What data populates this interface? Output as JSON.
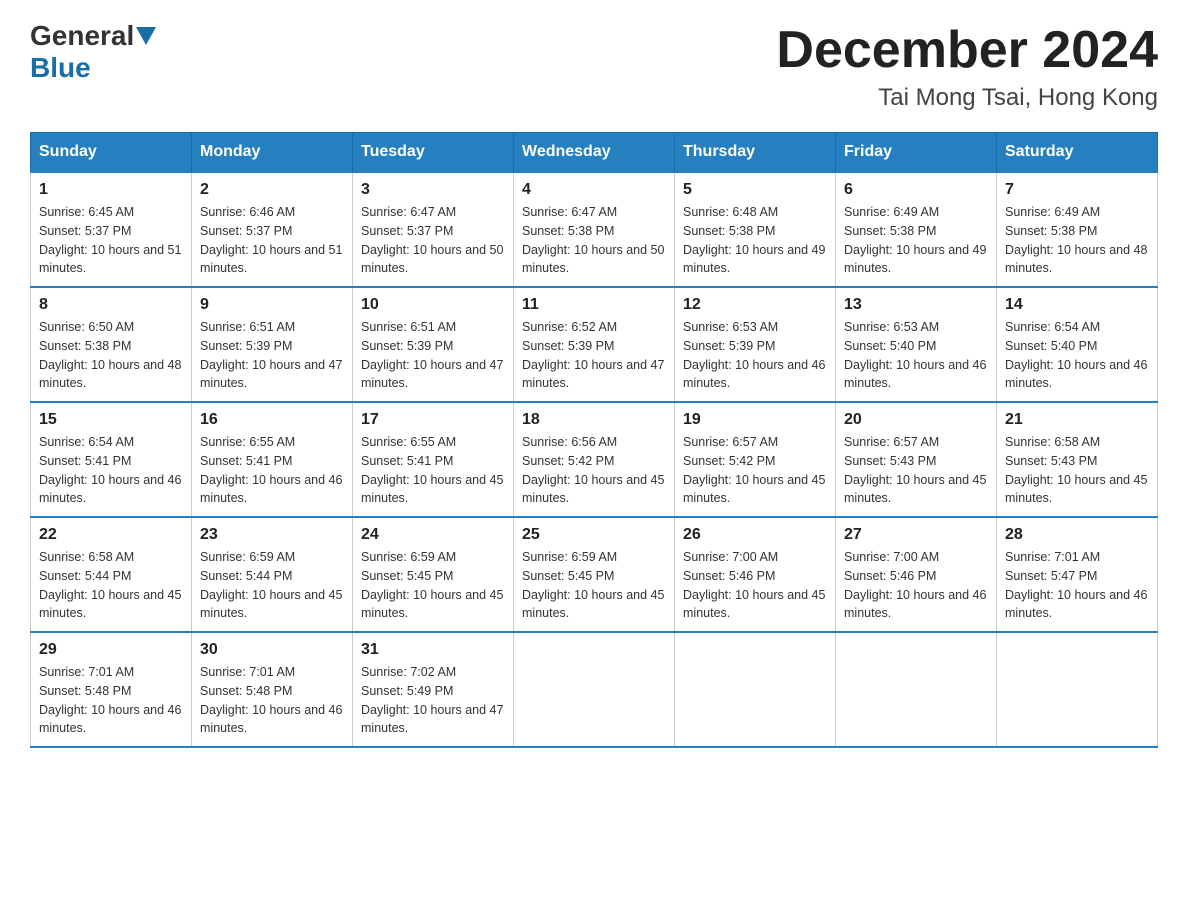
{
  "header": {
    "logo_general": "General",
    "logo_blue": "Blue",
    "month_title": "December 2024",
    "location": "Tai Mong Tsai, Hong Kong"
  },
  "days_of_week": [
    "Sunday",
    "Monday",
    "Tuesday",
    "Wednesday",
    "Thursday",
    "Friday",
    "Saturday"
  ],
  "weeks": [
    [
      {
        "day": "1",
        "sunrise": "6:45 AM",
        "sunset": "5:37 PM",
        "daylight": "10 hours and 51 minutes."
      },
      {
        "day": "2",
        "sunrise": "6:46 AM",
        "sunset": "5:37 PM",
        "daylight": "10 hours and 51 minutes."
      },
      {
        "day": "3",
        "sunrise": "6:47 AM",
        "sunset": "5:37 PM",
        "daylight": "10 hours and 50 minutes."
      },
      {
        "day": "4",
        "sunrise": "6:47 AM",
        "sunset": "5:38 PM",
        "daylight": "10 hours and 50 minutes."
      },
      {
        "day": "5",
        "sunrise": "6:48 AM",
        "sunset": "5:38 PM",
        "daylight": "10 hours and 49 minutes."
      },
      {
        "day": "6",
        "sunrise": "6:49 AM",
        "sunset": "5:38 PM",
        "daylight": "10 hours and 49 minutes."
      },
      {
        "day": "7",
        "sunrise": "6:49 AM",
        "sunset": "5:38 PM",
        "daylight": "10 hours and 48 minutes."
      }
    ],
    [
      {
        "day": "8",
        "sunrise": "6:50 AM",
        "sunset": "5:38 PM",
        "daylight": "10 hours and 48 minutes."
      },
      {
        "day": "9",
        "sunrise": "6:51 AM",
        "sunset": "5:39 PM",
        "daylight": "10 hours and 47 minutes."
      },
      {
        "day": "10",
        "sunrise": "6:51 AM",
        "sunset": "5:39 PM",
        "daylight": "10 hours and 47 minutes."
      },
      {
        "day": "11",
        "sunrise": "6:52 AM",
        "sunset": "5:39 PM",
        "daylight": "10 hours and 47 minutes."
      },
      {
        "day": "12",
        "sunrise": "6:53 AM",
        "sunset": "5:39 PM",
        "daylight": "10 hours and 46 minutes."
      },
      {
        "day": "13",
        "sunrise": "6:53 AM",
        "sunset": "5:40 PM",
        "daylight": "10 hours and 46 minutes."
      },
      {
        "day": "14",
        "sunrise": "6:54 AM",
        "sunset": "5:40 PM",
        "daylight": "10 hours and 46 minutes."
      }
    ],
    [
      {
        "day": "15",
        "sunrise": "6:54 AM",
        "sunset": "5:41 PM",
        "daylight": "10 hours and 46 minutes."
      },
      {
        "day": "16",
        "sunrise": "6:55 AM",
        "sunset": "5:41 PM",
        "daylight": "10 hours and 46 minutes."
      },
      {
        "day": "17",
        "sunrise": "6:55 AM",
        "sunset": "5:41 PM",
        "daylight": "10 hours and 45 minutes."
      },
      {
        "day": "18",
        "sunrise": "6:56 AM",
        "sunset": "5:42 PM",
        "daylight": "10 hours and 45 minutes."
      },
      {
        "day": "19",
        "sunrise": "6:57 AM",
        "sunset": "5:42 PM",
        "daylight": "10 hours and 45 minutes."
      },
      {
        "day": "20",
        "sunrise": "6:57 AM",
        "sunset": "5:43 PM",
        "daylight": "10 hours and 45 minutes."
      },
      {
        "day": "21",
        "sunrise": "6:58 AM",
        "sunset": "5:43 PM",
        "daylight": "10 hours and 45 minutes."
      }
    ],
    [
      {
        "day": "22",
        "sunrise": "6:58 AM",
        "sunset": "5:44 PM",
        "daylight": "10 hours and 45 minutes."
      },
      {
        "day": "23",
        "sunrise": "6:59 AM",
        "sunset": "5:44 PM",
        "daylight": "10 hours and 45 minutes."
      },
      {
        "day": "24",
        "sunrise": "6:59 AM",
        "sunset": "5:45 PM",
        "daylight": "10 hours and 45 minutes."
      },
      {
        "day": "25",
        "sunrise": "6:59 AM",
        "sunset": "5:45 PM",
        "daylight": "10 hours and 45 minutes."
      },
      {
        "day": "26",
        "sunrise": "7:00 AM",
        "sunset": "5:46 PM",
        "daylight": "10 hours and 45 minutes."
      },
      {
        "day": "27",
        "sunrise": "7:00 AM",
        "sunset": "5:46 PM",
        "daylight": "10 hours and 46 minutes."
      },
      {
        "day": "28",
        "sunrise": "7:01 AM",
        "sunset": "5:47 PM",
        "daylight": "10 hours and 46 minutes."
      }
    ],
    [
      {
        "day": "29",
        "sunrise": "7:01 AM",
        "sunset": "5:48 PM",
        "daylight": "10 hours and 46 minutes."
      },
      {
        "day": "30",
        "sunrise": "7:01 AM",
        "sunset": "5:48 PM",
        "daylight": "10 hours and 46 minutes."
      },
      {
        "day": "31",
        "sunrise": "7:02 AM",
        "sunset": "5:49 PM",
        "daylight": "10 hours and 47 minutes."
      },
      null,
      null,
      null,
      null
    ]
  ]
}
